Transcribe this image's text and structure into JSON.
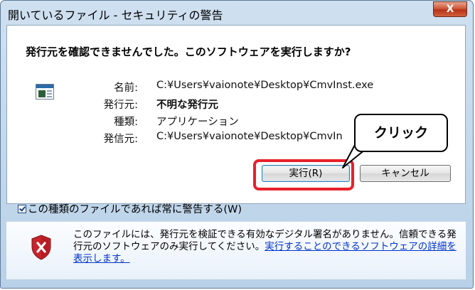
{
  "window": {
    "title": "開いているファイル - セキュリティの警告",
    "close_label": "X"
  },
  "dialog": {
    "question": "発行元を確認できませんでした。このソフトウェアを実行しますか?",
    "fields": [
      {
        "label": "名前:",
        "value": "C:¥Users¥vaionote¥Desktop¥CmvInst.exe"
      },
      {
        "label": "発行元:",
        "value": "不明な発行元"
      },
      {
        "label": "種類:",
        "value": "アプリケーション"
      },
      {
        "label": "発信元:",
        "value": "C:¥Users¥vaionote¥Desktop¥CmvIn"
      }
    ],
    "run_button": "実行(R)",
    "cancel_button": "キャンセル",
    "checkbox_label": "この種類のファイルであれば常に警告する(W)",
    "checkbox_checked": true
  },
  "annotation": {
    "callout_text": "クリック",
    "highlight_color": "#e8212b"
  },
  "warning": {
    "text": "このファイルには、発行元を検証できる有効なデジタル署名がありません。信頼できる発行元のソフトウェアのみ実行してください。",
    "link_text": "実行することのできるソフトウェアの詳細を表示します。",
    "icon": "shield-x-icon"
  }
}
